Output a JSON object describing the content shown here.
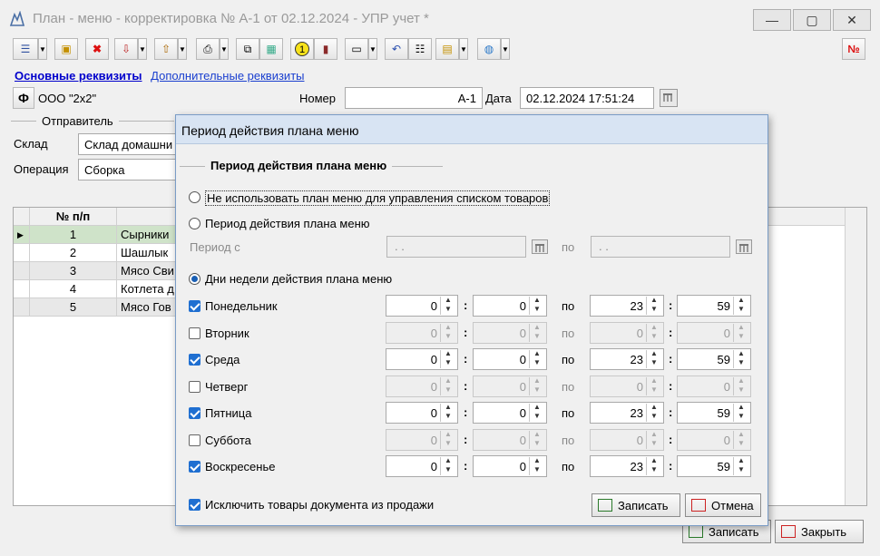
{
  "window": {
    "title": "План - меню - корректировка № А-1 от 02.12.2024 - УПР учет *",
    "minimize": "—",
    "maximize": "▢",
    "close": "✕"
  },
  "toolbar": {
    "no_label": "№"
  },
  "tabs": {
    "main": "Основные реквизиты",
    "extra": "Дополнительные реквизиты"
  },
  "header": {
    "org_button": "Ф",
    "org": "ООО \"2x2\"",
    "number_label": "Номер",
    "number_value": "А-1",
    "date_label": "Дата",
    "date_value": "02.12.2024 17:51:24",
    "sender_group": "Отправитель",
    "warehouse_label": "Склад",
    "warehouse_value": "Склад домашни",
    "operation_label": "Операция",
    "operation_value": "Сборка"
  },
  "grid": {
    "col_num": "№ п/п",
    "rows": [
      {
        "n": "1",
        "name": "Сырники"
      },
      {
        "n": "2",
        "name": "Шашлык"
      },
      {
        "n": "3",
        "name": "Мясо Сви"
      },
      {
        "n": "4",
        "name": "Котлета д"
      },
      {
        "n": "5",
        "name": "Мясо Гов"
      }
    ]
  },
  "footer": {
    "save": "Записать",
    "close": "Закрыть"
  },
  "dialog": {
    "title": "Период действия плана меню",
    "group": "Период действия плана меню",
    "opt_none": "Не использовать план меню для управления списком товаров",
    "opt_period": "Период действия плана меню",
    "period_from": "Период с",
    "date_placeholder": " .  .",
    "po": "по",
    "opt_days": "Дни недели действия плана меню",
    "days": [
      {
        "name": "Понедельник",
        "checked": true,
        "h1": "0",
        "m1": "0",
        "h2": "23",
        "m2": "59"
      },
      {
        "name": "Вторник",
        "checked": false,
        "h1": "0",
        "m1": "0",
        "h2": "0",
        "m2": "0"
      },
      {
        "name": "Среда",
        "checked": true,
        "h1": "0",
        "m1": "0",
        "h2": "23",
        "m2": "59"
      },
      {
        "name": "Четверг",
        "checked": false,
        "h1": "0",
        "m1": "0",
        "h2": "0",
        "m2": "0"
      },
      {
        "name": "Пятница",
        "checked": true,
        "h1": "0",
        "m1": "0",
        "h2": "23",
        "m2": "59"
      },
      {
        "name": "Суббота",
        "checked": false,
        "h1": "0",
        "m1": "0",
        "h2": "0",
        "m2": "0"
      },
      {
        "name": "Воскресенье",
        "checked": true,
        "h1": "0",
        "m1": "0",
        "h2": "23",
        "m2": "59"
      }
    ],
    "exclude": "Исключить товары документа из продажи",
    "save": "Записать",
    "cancel": "Отмена"
  }
}
